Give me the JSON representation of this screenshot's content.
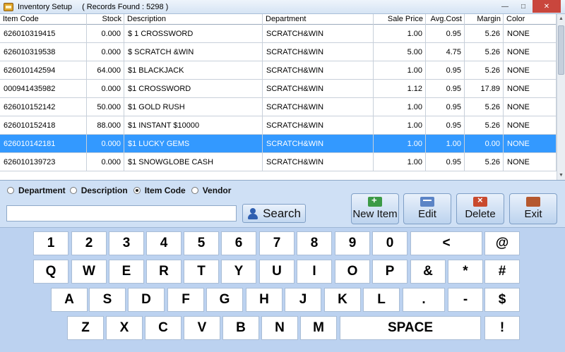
{
  "window": {
    "title": "Inventory Setup",
    "records_found": "( Records Found : 5298 )"
  },
  "grid": {
    "columns": [
      "Item Code",
      "Stock",
      "Description",
      "Department",
      "Sale Price",
      "Avg.Cost",
      "Margin",
      "Color"
    ],
    "rows": [
      [
        "626010319415",
        "0.000",
        "$ 1 CROSSWORD",
        "SCRATCH&WIN",
        "1.00",
        "0.95",
        "5.26",
        "NONE"
      ],
      [
        "626010319538",
        "0.000",
        "$ SCRATCH &WIN",
        "SCRATCH&WIN",
        "5.00",
        "4.75",
        "5.26",
        "NONE"
      ],
      [
        "626010142594",
        "64.000",
        "$1 BLACKJACK",
        "SCRATCH&WIN",
        "1.00",
        "0.95",
        "5.26",
        "NONE"
      ],
      [
        "000941435982",
        "0.000",
        "$1 CROSSWORD",
        "SCRATCH&WIN",
        "1.12",
        "0.95",
        "17.89",
        "NONE"
      ],
      [
        "626010152142",
        "50.000",
        "$1 GOLD RUSH",
        "SCRATCH&WIN",
        "1.00",
        "0.95",
        "5.26",
        "NONE"
      ],
      [
        "626010152418",
        "88.000",
        "$1 INSTANT $10000",
        "SCRATCH&WIN",
        "1.00",
        "0.95",
        "5.26",
        "NONE"
      ],
      [
        "626010142181",
        "0.000",
        "$1 LUCKY GEMS",
        "SCRATCH&WIN",
        "1.00",
        "1.00",
        "0.00",
        "NONE"
      ],
      [
        "626010139723",
        "0.000",
        "$1 SNOWGLOBE CASH",
        "SCRATCH&WIN",
        "1.00",
        "0.95",
        "5.26",
        "NONE"
      ]
    ],
    "selected_index": 6
  },
  "search": {
    "options": [
      "Department",
      "Description",
      "Item Code",
      "Vendor"
    ],
    "selected_option": "Item Code",
    "value": "",
    "placeholder": "",
    "button_label": "Search"
  },
  "actions": {
    "new_item": "New Item",
    "edit": "Edit",
    "delete": "Delete",
    "exit": "Exit"
  },
  "keyboard": {
    "row1": [
      "1",
      "2",
      "3",
      "4",
      "5",
      "6",
      "7",
      "8",
      "9",
      "0",
      "<",
      "@"
    ],
    "row2": [
      "Q",
      "W",
      "E",
      "R",
      "T",
      "Y",
      "U",
      "I",
      "O",
      "P",
      "&",
      "*",
      "#"
    ],
    "row3": [
      "A",
      "S",
      "D",
      "F",
      "G",
      "H",
      "J",
      "K",
      "L",
      ".",
      "-",
      "$"
    ],
    "row4": [
      "Z",
      "X",
      "C",
      "V",
      "B",
      "N",
      "M",
      "SPACE",
      "!"
    ]
  },
  "colors": {
    "selection": "#3399ff",
    "background": "#cfe0f5",
    "keyboard_bg": "#bcd2f0"
  }
}
